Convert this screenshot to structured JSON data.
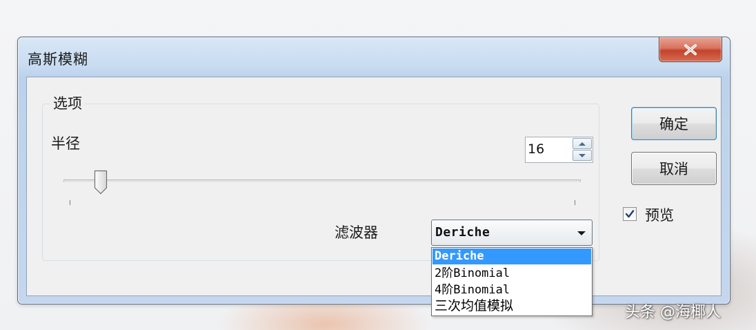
{
  "window": {
    "title": "高斯模糊",
    "frame_color": "#c4d7ee",
    "close_button_color": "#c2432b"
  },
  "options_group": {
    "label": "选项",
    "radius": {
      "label": "半径",
      "value": "16",
      "slider_value": 16
    },
    "filter": {
      "label": "滤波器",
      "selected": "Deriche",
      "options": [
        "Deriche",
        "2阶Binomial",
        "4阶Binomial",
        "三次均值模拟"
      ],
      "highlight_color": "#3399ff"
    }
  },
  "buttons": {
    "ok_label": "确定",
    "cancel_label": "取消"
  },
  "preview": {
    "label": "预览",
    "checked": true
  },
  "icons": {
    "close": "close-icon",
    "spin_up": "chevron-up-icon",
    "spin_down": "chevron-down-icon",
    "combo": "dropdown-arrow-icon",
    "check": "check-icon"
  },
  "watermark": {
    "text": "头条 @海椰人"
  }
}
